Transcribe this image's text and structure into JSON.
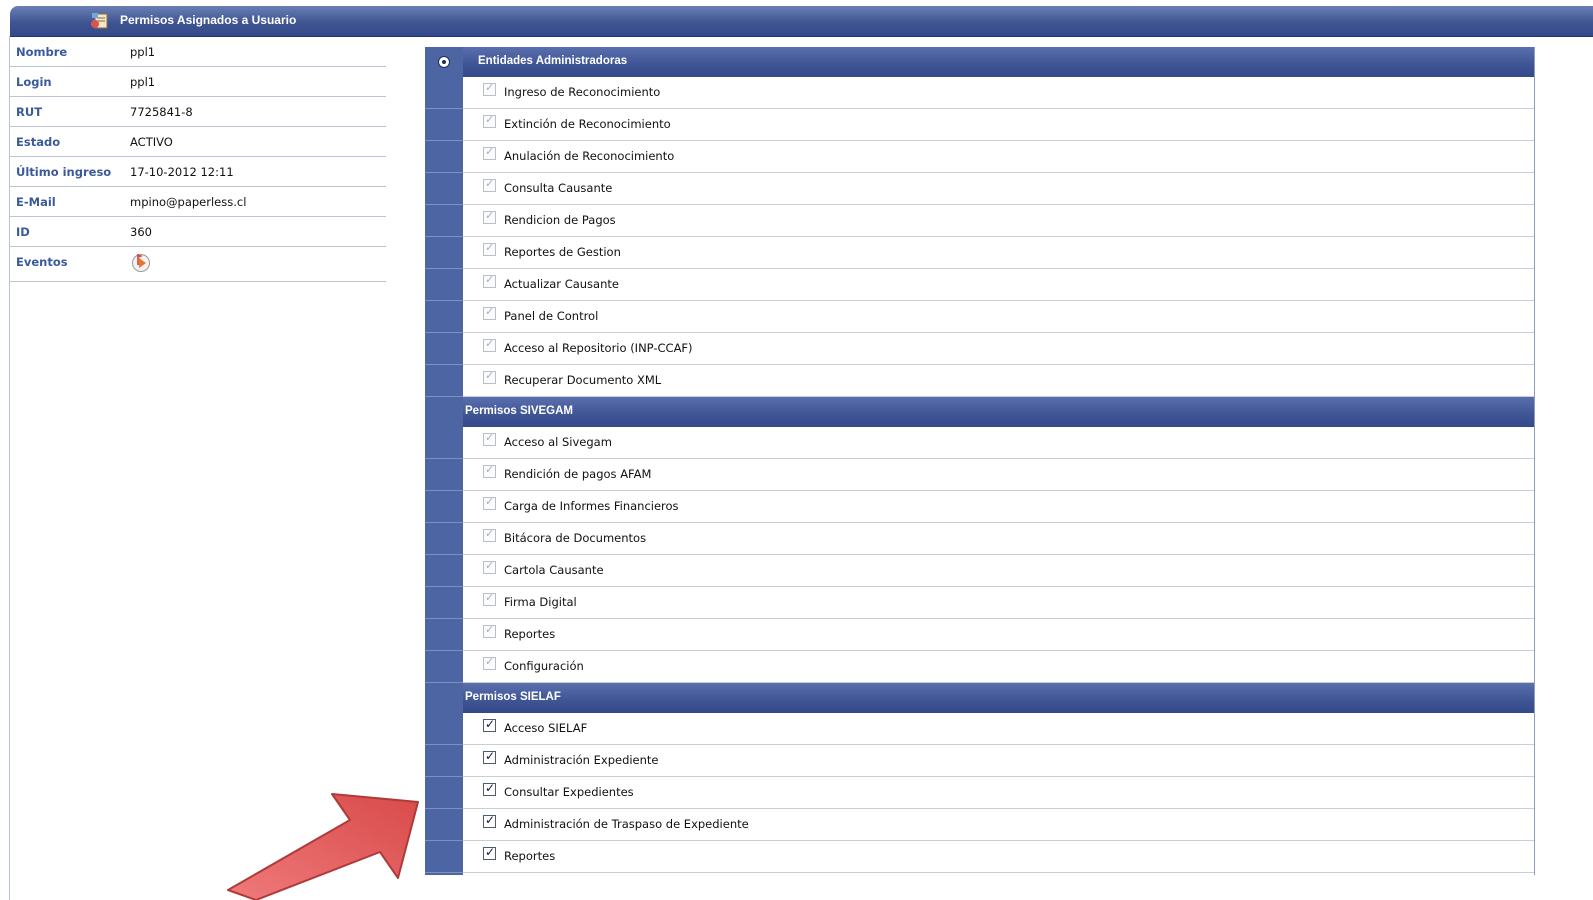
{
  "window": {
    "title": "Permisos Asignados a Usuario",
    "icon": "user-permissions-icon"
  },
  "user": {
    "fields": [
      {
        "label": "Nombre",
        "value": "ppl1"
      },
      {
        "label": "Login",
        "value": "ppl1"
      },
      {
        "label": "RUT",
        "value": "7725841-8"
      },
      {
        "label": "Estado",
        "value": "ACTIVO"
      },
      {
        "label": "Último ingreso",
        "value": "17-10-2012 12:11"
      },
      {
        "label": "E-Mail",
        "value": "mpino@paperless.cl"
      },
      {
        "label": "ID",
        "value": "360"
      }
    ],
    "events_label": "Eventos",
    "events_icon": "play-flag-icon"
  },
  "permissions": {
    "groups": [
      {
        "title": "Entidades Administradoras",
        "items": [
          {
            "label": "Ingreso de Reconocimiento",
            "checked": true,
            "enabled": false
          },
          {
            "label": "Extinción de Reconocimiento",
            "checked": true,
            "enabled": false
          },
          {
            "label": "Anulación de Reconocimiento",
            "checked": true,
            "enabled": false
          },
          {
            "label": "Consulta Causante",
            "checked": true,
            "enabled": false
          },
          {
            "label": "Rendicion de Pagos",
            "checked": true,
            "enabled": false
          },
          {
            "label": "Reportes de Gestion",
            "checked": true,
            "enabled": false
          },
          {
            "label": "Actualizar Causante",
            "checked": true,
            "enabled": false
          },
          {
            "label": "Panel de Control",
            "checked": true,
            "enabled": false
          },
          {
            "label": "Acceso al Repositorio (INP-CCAF)",
            "checked": true,
            "enabled": false
          },
          {
            "label": "Recuperar Documento XML",
            "checked": true,
            "enabled": false
          }
        ]
      },
      {
        "title": "Permisos SIVEGAM",
        "items": [
          {
            "label": "Acceso al Sivegam",
            "checked": true,
            "enabled": false
          },
          {
            "label": "Rendición de pagos AFAM",
            "checked": true,
            "enabled": false
          },
          {
            "label": "Carga de Informes Financieros",
            "checked": true,
            "enabled": false
          },
          {
            "label": "Bitácora de Documentos",
            "checked": true,
            "enabled": false
          },
          {
            "label": "Cartola Causante",
            "checked": true,
            "enabled": false
          },
          {
            "label": "Firma Digital",
            "checked": true,
            "enabled": false
          },
          {
            "label": "Reportes",
            "checked": true,
            "enabled": false
          },
          {
            "label": "Configuración",
            "checked": true,
            "enabled": false
          }
        ]
      },
      {
        "title": "Permisos SIELAF",
        "items": [
          {
            "label": "Acceso SIELAF",
            "checked": true,
            "enabled": true
          },
          {
            "label": "Administración Expediente",
            "checked": true,
            "enabled": true
          },
          {
            "label": "Consultar Expedientes",
            "checked": true,
            "enabled": true
          },
          {
            "label": "Administración de Traspaso de Expediente",
            "checked": true,
            "enabled": true
          },
          {
            "label": "Reportes",
            "checked": true,
            "enabled": true
          }
        ]
      }
    ]
  },
  "colors": {
    "header": "#3f5592",
    "sidebar": "#4e65a3",
    "label": "#3b5a9a",
    "arrow": "#e05050"
  }
}
